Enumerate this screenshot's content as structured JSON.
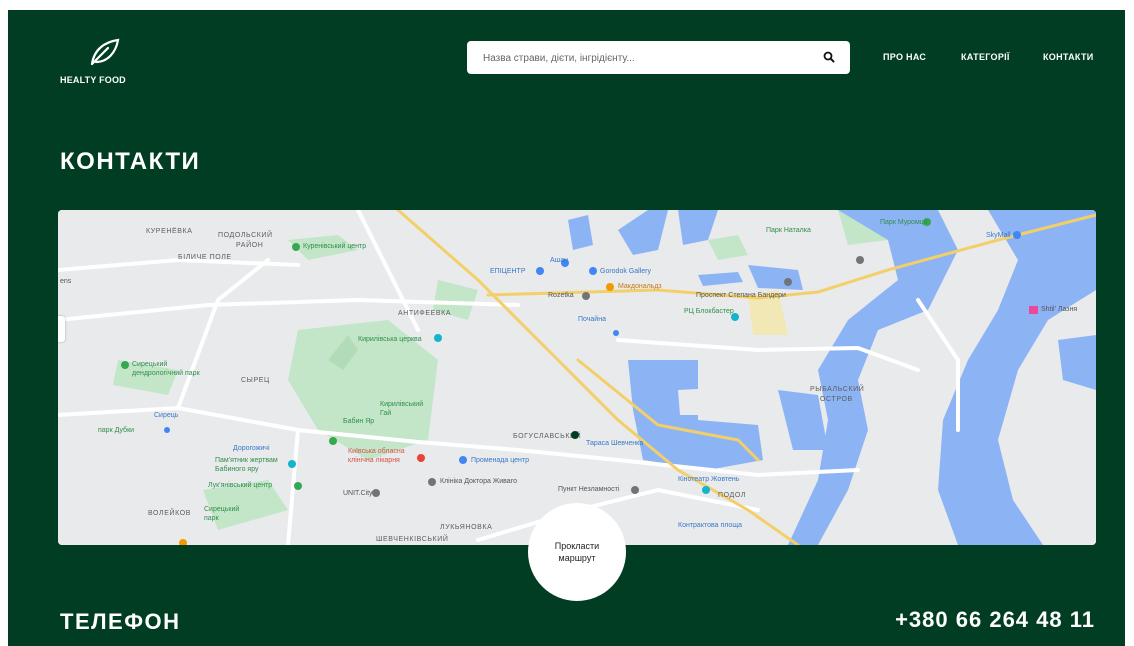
{
  "header": {
    "logo_text": "HEALTY FOOD",
    "search_placeholder": "Назва страви, дієти, інгрідієнту...",
    "nav": [
      "ПРО НАС",
      "КАТЕГОРІЇ",
      "КОНТАКТИ"
    ]
  },
  "contacts_title": "КОНТАКТИ",
  "map": {
    "labels": {
      "kurenevka": "КУРЕНЁВКА",
      "podilskyi": "ПОДОЛЬСКИЙ",
      "raion": "РАЙОН",
      "bilychi": "БІЛИЧЕ ПОЛЕ",
      "kurenivskyi_center": "Куренівський центр",
      "epicentr": "ЕПІЦЕНТР",
      "ashan": "Ашан",
      "gorodok": "Gorodok Gallery",
      "mcdonalds": "Макдональдз",
      "rozetka": "Rozetka",
      "antifeevka": "АНТИФЕЕВКА",
      "pochaina": "Почайна",
      "kyrylivska": "Кирилівська церква",
      "syretskyi_park": "Сирецький дендрологічний парк",
      "syrets": "СЫРЕЦ",
      "park_natalka": "Парк Наталка",
      "park_muromets": "Парк Муромця",
      "skymall": "SkyMall",
      "prospekt": "Проспект Степана Бандери",
      "rc_blockbuster": "РЦ Блокбастер",
      "rybalskyi": "РЫБАЛЬСКИЙ",
      "ostrov": "ОСТРОВ",
      "kyrylivskyi_gai": "Кирилівський Гай",
      "babyn_yar": "Бабин Яр",
      "bohuslavsky": "БОГУСЛАВСЬКИЙ",
      "taras": "Тарасa Шевченка",
      "hospital": "Київська обласна клінічна лікарня",
      "promenade": "Променада центр",
      "klinika": "Клініка Доктора Живаго",
      "punkt": "Пункт Незламності",
      "kinoteatr": "Кінотеатр Жовтень",
      "podil": "ПОДОЛ",
      "dorohozhychi": "Дорогожичі",
      "pamyatnyk": "Пам'ятник жертвам Бабиного яру",
      "lukyanivskyi": "Лук'янівський центр",
      "unit_city": "UNIT.City",
      "volkov": "ВОЛЕЙКОВ",
      "syretskyi_small": "Сирецький парк",
      "lukyanivka": "ЛУКЬЯНОВКА",
      "kontraktova": "Контрактова площа",
      "shevchenkivskyi": "ШЕВЧЕНКІВСЬКИЙ",
      "lazny": "Shtil' Лазня",
      "park_dubky": "парк Дубки",
      "syrets_metro": "Сирець",
      "ens": "ens"
    }
  },
  "route_button": "Прокласти маршрут",
  "phone_title": "ТЕЛЕФОН",
  "phone_number": "+380 66 264 48 11",
  "colors": {
    "background": "#003d23",
    "water": "#8cb4f5",
    "park": "#c3e6c8",
    "major_road": "#f3cf6a"
  }
}
